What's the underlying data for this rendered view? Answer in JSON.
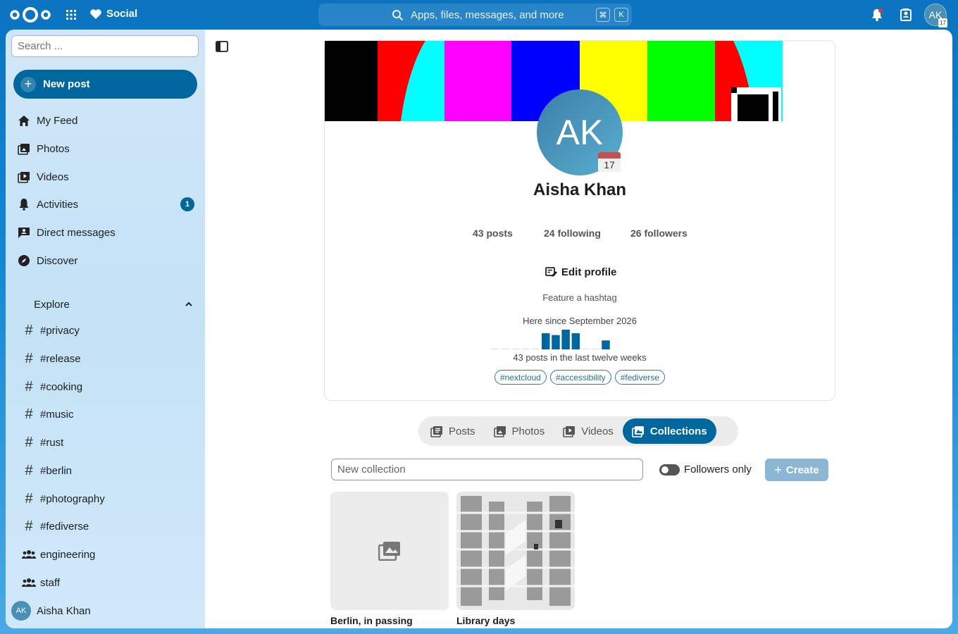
{
  "topbar": {
    "app_name": "Social",
    "search_placeholder": "Apps, files, messages, and more",
    "kbd_cmd": "⌘",
    "kbd_k": "K",
    "avatar_initials": "AK",
    "avatar_badge": "17"
  },
  "sidebar": {
    "search_placeholder": "Search ...",
    "new_post": "New post",
    "items": [
      {
        "label": "My Feed",
        "icon": "home-icon"
      },
      {
        "label": "Photos",
        "icon": "image-icon"
      },
      {
        "label": "Videos",
        "icon": "video-icon"
      },
      {
        "label": "Activities",
        "icon": "bell-icon",
        "badge": "1"
      },
      {
        "label": "Direct messages",
        "icon": "message-icon"
      },
      {
        "label": "Discover",
        "icon": "compass-icon"
      }
    ],
    "explore_label": "Explore",
    "tags": [
      "#privacy",
      "#release",
      "#cooking",
      "#music",
      "#rust",
      "#berlin",
      "#photography",
      "#fediverse"
    ],
    "groups": [
      "engineering",
      "staff"
    ],
    "user_initials": "AK",
    "user_name": "Aisha Khan"
  },
  "profile": {
    "initials": "AK",
    "calendar_day": "17",
    "name": "Aisha Khan",
    "posts": "43 posts",
    "following": "24 following",
    "followers": "26 followers",
    "edit_profile": "Edit profile",
    "feature_hashtag": "Feature a hashtag",
    "since": "Here since September 2026",
    "activity_caption": "43 posts in the last twelve weeks",
    "weekly_posts": [
      0,
      0,
      0,
      0,
      0,
      9,
      8,
      11,
      9,
      0,
      0,
      5
    ],
    "hashtags": [
      "#nextcloud",
      "#accessibility",
      "#fediverse"
    ]
  },
  "tabs": [
    {
      "label": "Posts",
      "icon": "posts-icon"
    },
    {
      "label": "Photos",
      "icon": "image-icon"
    },
    {
      "label": "Videos",
      "icon": "video-icon"
    },
    {
      "label": "Collections",
      "icon": "collections-icon",
      "active": true
    }
  ],
  "collections": {
    "new_placeholder": "New collection",
    "followers_only": "Followers only",
    "create": "Create",
    "items": [
      {
        "title": "Berlin, in passing"
      },
      {
        "title": "Library days"
      }
    ]
  },
  "colors": {
    "accent": "#00679e",
    "banner_bars": [
      "#000000",
      "#ff0000",
      "#00ffff",
      "#ff00ff",
      "#0000ff",
      "#ffff00",
      "#00ff00",
      "#ff0000",
      "#00ffff"
    ]
  }
}
